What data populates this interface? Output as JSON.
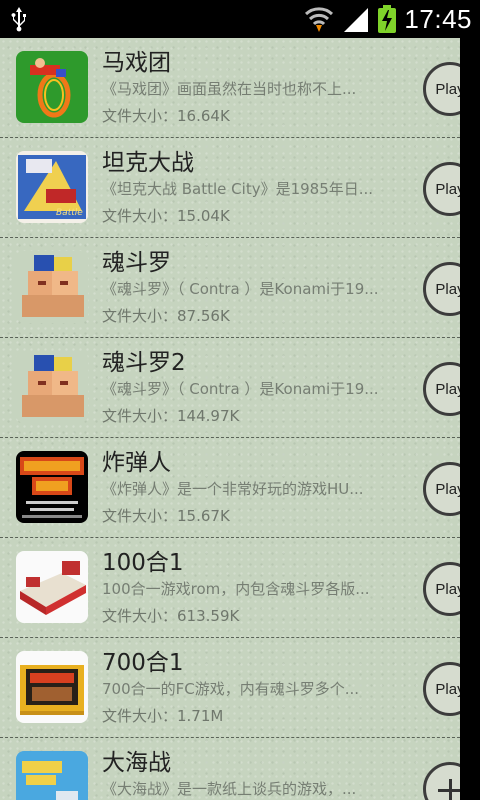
{
  "status_bar": {
    "time": "17:45",
    "icons": [
      "usb-icon",
      "wifi-icon",
      "signal-icon",
      "battery-charging-icon"
    ]
  },
  "games": [
    {
      "title": "马戏团",
      "description": "《马戏团》画面虽然在当时也称不上...",
      "size": "文件大小：16.64K",
      "action": "Play",
      "thumb": "circus-thumbnail"
    },
    {
      "title": "坦克大战",
      "description": "《坦克大战 Battle City》是1985年日...",
      "size": "文件大小：15.04K",
      "action": "Play",
      "thumb": "battle-city-thumbnail"
    },
    {
      "title": "魂斗罗",
      "description": "《魂斗罗》（ Contra ）是Konami于19...",
      "size": "文件大小：87.56K",
      "action": "Play",
      "thumb": "contra-thumbnail"
    },
    {
      "title": "魂斗罗2",
      "description": "《魂斗罗》（ Contra ）是Konami于19...",
      "size": "文件大小：144.97K",
      "action": "Play",
      "thumb": "contra2-thumbnail"
    },
    {
      "title": "炸弹人",
      "description": "《炸弹人》是一个非常好玩的游戏HU...",
      "size": "文件大小：15.67K",
      "action": "Play",
      "thumb": "bomberman-thumbnail"
    },
    {
      "title": "100合1",
      "description": "100合一游戏rom，内包含魂斗罗各版...",
      "size": "文件大小：613.59K",
      "action": "Play",
      "thumb": "famicom-console-thumbnail"
    },
    {
      "title": "700合1",
      "description": "700合一的FC游戏，内有魂斗罗多个...",
      "size": "文件大小：1.71M",
      "action": "Play",
      "thumb": "cartridge-thumbnail"
    },
    {
      "title": "大海战",
      "description": "《大海战》是一款纸上谈兵的游戏，...",
      "size": "",
      "action": "",
      "thumb": "navy-blue-thumbnail"
    }
  ]
}
